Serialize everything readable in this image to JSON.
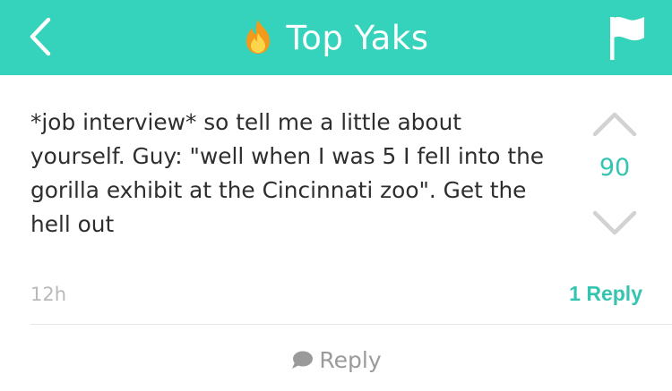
{
  "header": {
    "title": "Top Yaks",
    "accent_color": "#35d3bb",
    "back_icon": "chevron-left-icon",
    "title_icon": "fire-icon",
    "flag_icon": "flag-icon"
  },
  "post": {
    "text": "*job interview* so tell me a little about yourself. Guy: \"well when I was 5 I fell into the gorilla exhibit at the Cincinnati zoo\". Get the hell out",
    "score": "90",
    "timestamp": "12h",
    "reply_count_label": "1 Reply"
  },
  "footer": {
    "reply_label": "Reply",
    "reply_icon": "speech-bubble-icon"
  }
}
